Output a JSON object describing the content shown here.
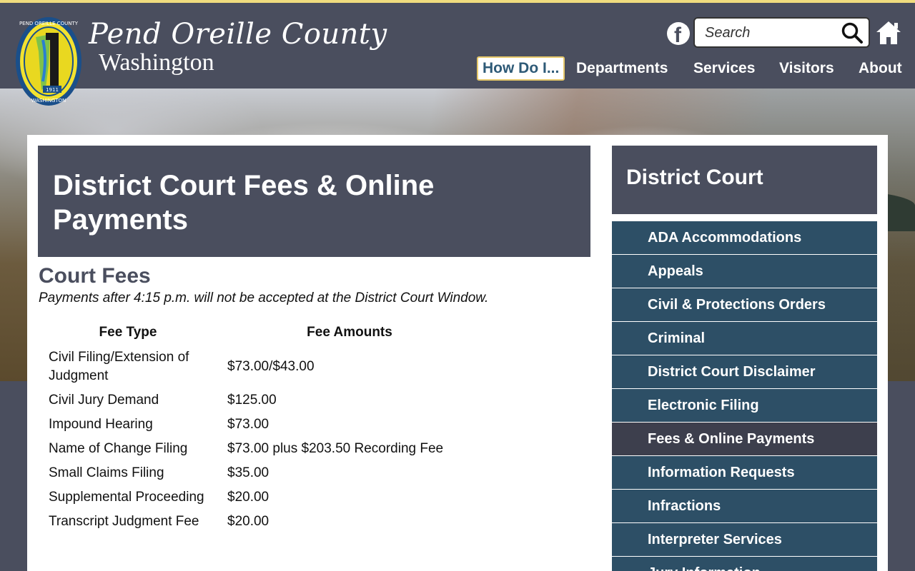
{
  "header": {
    "logo_line1": "Pend Oreille County",
    "logo_line2": "Washington",
    "seal_text_top": "PEND OREILLE COUNTY",
    "seal_text_bottom": "WASHINGTON",
    "seal_year": "1911",
    "search_placeholder": "Search",
    "nav": [
      {
        "label": "How Do I..."
      },
      {
        "label": "Departments"
      },
      {
        "label": "Services"
      },
      {
        "label": "Visitors"
      },
      {
        "label": "About"
      }
    ]
  },
  "main": {
    "page_title": "District Court Fees & Online Payments",
    "section_heading": "Court Fees",
    "notice": "Payments after 4:15 p.m. will not be accepted at the District Court Window.",
    "table": {
      "headers": [
        "Fee Type",
        "Fee Amounts"
      ],
      "rows": [
        {
          "type": "Civil Filing/Extension of Judgment",
          "amount": "$73.00/$43.00"
        },
        {
          "type": "Civil Jury Demand",
          "amount": "$125.00"
        },
        {
          "type": "Impound Hearing",
          "amount": "$73.00"
        },
        {
          "type": "Name of Change Filing",
          "amount": "$73.00 plus $203.50 Recording Fee"
        },
        {
          "type": "Small Claims Filing",
          "amount": "$35.00"
        },
        {
          "type": "Supplemental Proceeding",
          "amount": "$20.00"
        },
        {
          "type": "Transcript Judgment Fee",
          "amount": "$20.00"
        }
      ]
    }
  },
  "sidebar": {
    "title": "District Court",
    "items": [
      {
        "label": "ADA Accommodations"
      },
      {
        "label": "Appeals"
      },
      {
        "label": "Civil & Protections Orders"
      },
      {
        "label": "Criminal"
      },
      {
        "label": "District Court Disclaimer"
      },
      {
        "label": "Electronic Filing"
      },
      {
        "label": "Fees & Online Payments"
      },
      {
        "label": "Information Requests"
      },
      {
        "label": "Infractions"
      },
      {
        "label": "Interpreter Services"
      },
      {
        "label": "Jury Information"
      }
    ]
  },
  "icons": {
    "facebook": "facebook-icon",
    "search": "search-icon",
    "home": "home-icon"
  },
  "colors": {
    "header_bg": "#4a4e5e",
    "accent_stripe": "#f0dc7e",
    "sidebar_item_bg": "#2d4f66",
    "sidebar_active_bg": "#3d3f4d",
    "nav_active_text": "#2e5a77"
  }
}
